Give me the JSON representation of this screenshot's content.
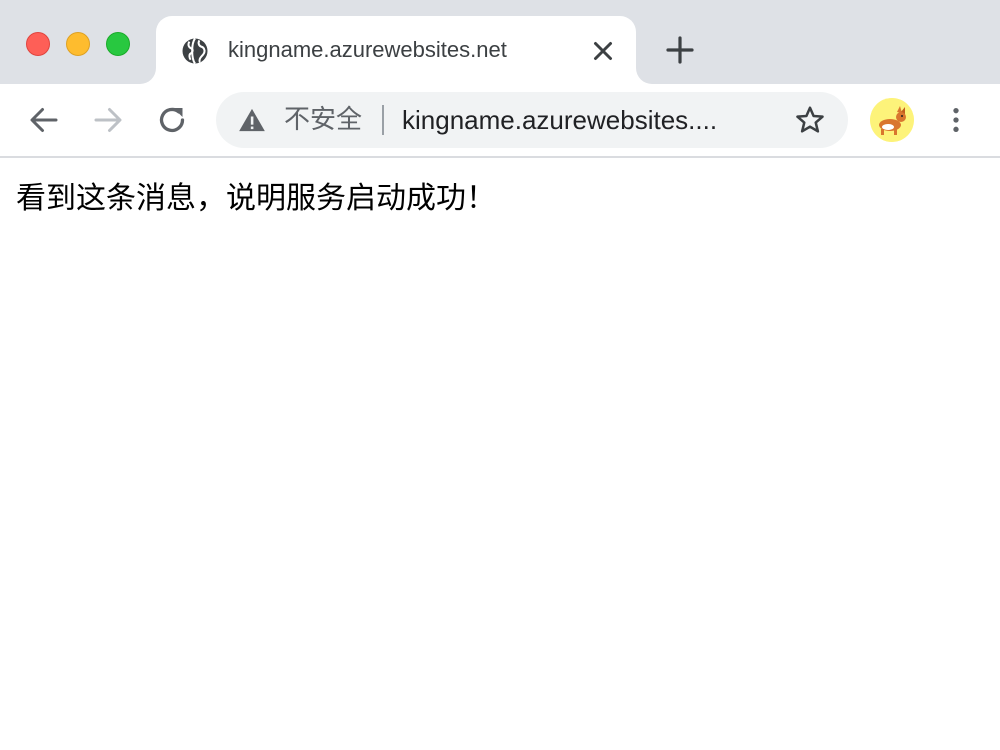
{
  "window": {
    "controls": {
      "close": "close",
      "minimize": "minimize",
      "zoom": "zoom"
    }
  },
  "tab": {
    "title": "kingname.azurewebsites.net",
    "favicon": "globe-icon",
    "close_icon": "close-icon"
  },
  "new_tab": {
    "icon": "plus-icon"
  },
  "toolbar": {
    "back_icon": "arrow-left-icon",
    "forward_icon": "arrow-right-icon",
    "reload_icon": "reload-icon",
    "menu_icon": "kebab-menu-icon"
  },
  "omnibox": {
    "security_icon": "warning-icon",
    "security_label": "不安全",
    "url": "kingname.azurewebsites....",
    "bookmark_icon": "star-icon"
  },
  "profile": {
    "avatar_icon": "corgi-avatar"
  },
  "page": {
    "message": "看到这条消息，说明服务启动成功！"
  },
  "colors": {
    "tabstrip_bg": "#dee1e6",
    "omnibox_bg": "#f1f3f4",
    "traffic_close": "#fe5f57",
    "traffic_minimize": "#febc2e",
    "traffic_zoom": "#28c840",
    "avatar_bg": "#fdf37a"
  }
}
